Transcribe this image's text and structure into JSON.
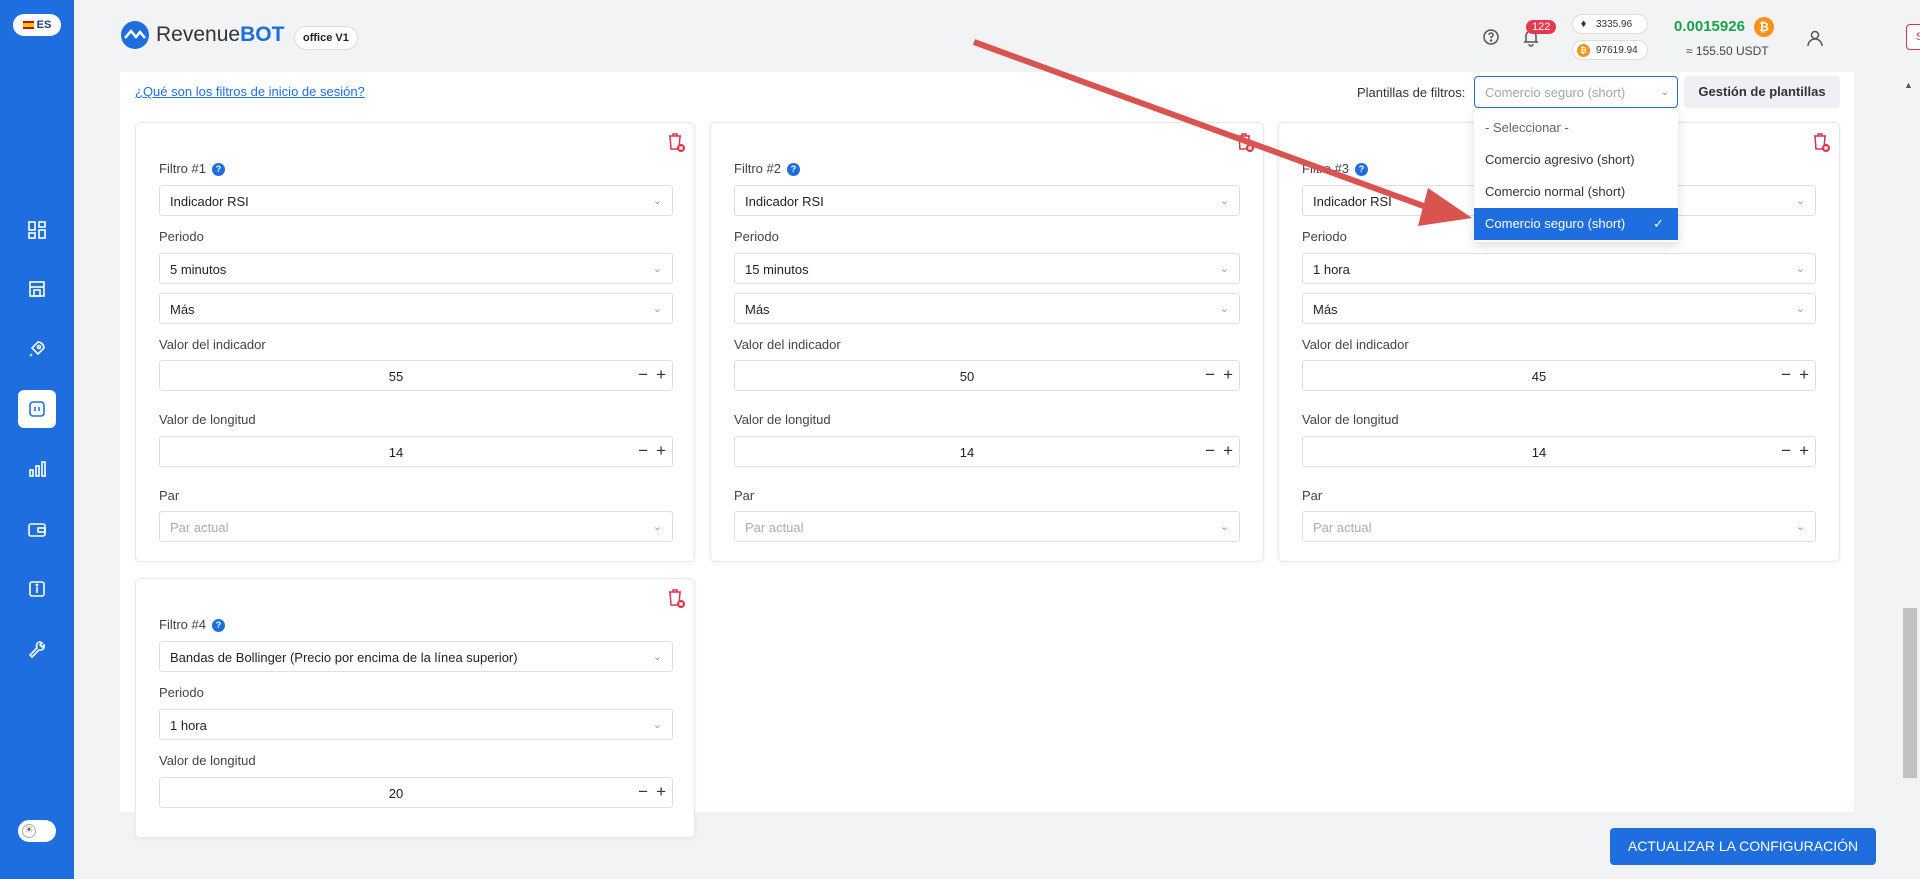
{
  "sidebar": {
    "language": "ES"
  },
  "header": {
    "brand_first": "Revenue",
    "brand_second": "BOT",
    "office_badge": "office V1",
    "notifications_count": "122",
    "eth_price": "3335.96",
    "btc_price": "97619.94",
    "balance": "0.0015926",
    "balance_usdt": "≈ 155.50 USDT",
    "logout_label": "Salir"
  },
  "toolbar": {
    "help_link": "¿Qué son los filtros de inicio de sesión?",
    "templates_label": "Plantillas de filtros:",
    "templates_value": "Comercio seguro (short)",
    "templates_button": "Gestión de plantillas"
  },
  "dropdown": {
    "options": [
      "- Seleccionar -",
      "Comercio agresivo (short)",
      "Comercio normal (short)",
      "Comercio seguro (short)"
    ]
  },
  "labels": {
    "period": "Periodo",
    "indicator_value": "Valor del indicador",
    "length_value": "Valor de longitud",
    "pair": "Par",
    "pair_placeholder": "Par actual"
  },
  "filters": [
    {
      "title": "Filtro #1",
      "indicator": "Indicador RSI",
      "period": "5 minutos",
      "direction": "Más",
      "indicator_value": "55",
      "length": "14"
    },
    {
      "title": "Filtro #2",
      "indicator": "Indicador RSI",
      "period": "15 minutos",
      "direction": "Más",
      "indicator_value": "50",
      "length": "14"
    },
    {
      "title": "Filtro #3",
      "indicator": "Indicador RSI",
      "period": "1 hora",
      "direction": "Más",
      "indicator_value": "45",
      "length": "14"
    },
    {
      "title": "Filtro #4",
      "indicator": "Bandas de Bollinger (Precio por encima de la línea superior)",
      "period": "1 hora",
      "length": "20"
    }
  ],
  "footer": {
    "update_button": "ACTUALIZAR LA CONFIGURACIÓN"
  },
  "colors": {
    "primary": "#1f6ee0",
    "danger": "#d9334a",
    "success": "#17a34a",
    "bitcoin": "#f7931a",
    "annotation_arrow": "#d9534f"
  }
}
